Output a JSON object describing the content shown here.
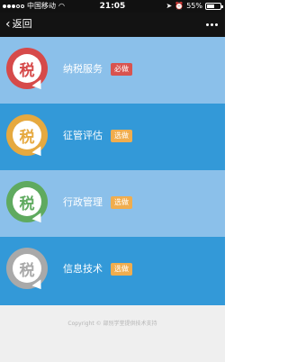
{
  "status_bar": {
    "carrier": "中国移动",
    "time": "21:05",
    "battery": "55%",
    "battery_level": 0.55
  },
  "nav": {
    "back_label": "返回"
  },
  "items": [
    {
      "icon_char": "税",
      "label": "纳税服务",
      "badge": "必做",
      "bg": "#8bc0ea",
      "ring": "#d64a4a",
      "badge_color": "#d9534f"
    },
    {
      "icon_char": "税",
      "label": "征管评估",
      "badge": "选做",
      "bg": "#3399d8",
      "ring": "#e6a93f",
      "badge_color": "#f0ad4e"
    },
    {
      "icon_char": "税",
      "label": "行政管理",
      "badge": "选做",
      "bg": "#8bc0ea",
      "ring": "#5faa5f",
      "badge_color": "#f0ad4e"
    },
    {
      "icon_char": "税",
      "label": "信息技术",
      "badge": "选做",
      "bg": "#3399d8",
      "ring": "#a9a9a9",
      "badge_color": "#f0ad4e"
    }
  ],
  "footer": {
    "copyright": "Copyright © 部别学堂提供技术支持"
  }
}
